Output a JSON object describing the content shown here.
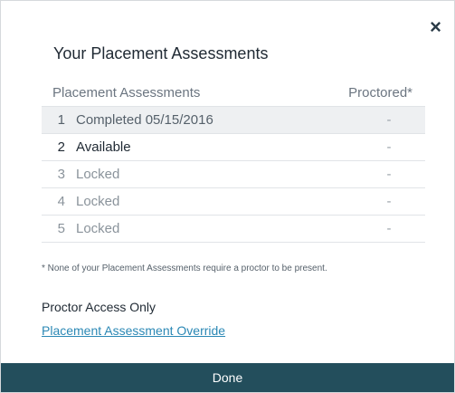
{
  "dialog": {
    "close_symbol": "×",
    "title": "Your Placement Assessments",
    "table": {
      "headers": {
        "assessments": "Placement Assessments",
        "proctored": "Proctored*"
      },
      "rows": [
        {
          "num": "1",
          "status": "Completed 05/15/2016",
          "proctored": "-"
        },
        {
          "num": "2",
          "status": "Available",
          "proctored": "-"
        },
        {
          "num": "3",
          "status": "Locked",
          "proctored": "-"
        },
        {
          "num": "4",
          "status": "Locked",
          "proctored": "-"
        },
        {
          "num": "5",
          "status": "Locked",
          "proctored": "-"
        }
      ]
    },
    "footnote": "* None of your Placement Assessments require a proctor to be present.",
    "proctor_heading": "Proctor Access Only",
    "override_link": "Placement Assessment Override",
    "done_label": "Done"
  },
  "colors": {
    "done_bar": "#234e5c",
    "link": "#2b88b5",
    "highlight_row": "#eef0f2"
  }
}
